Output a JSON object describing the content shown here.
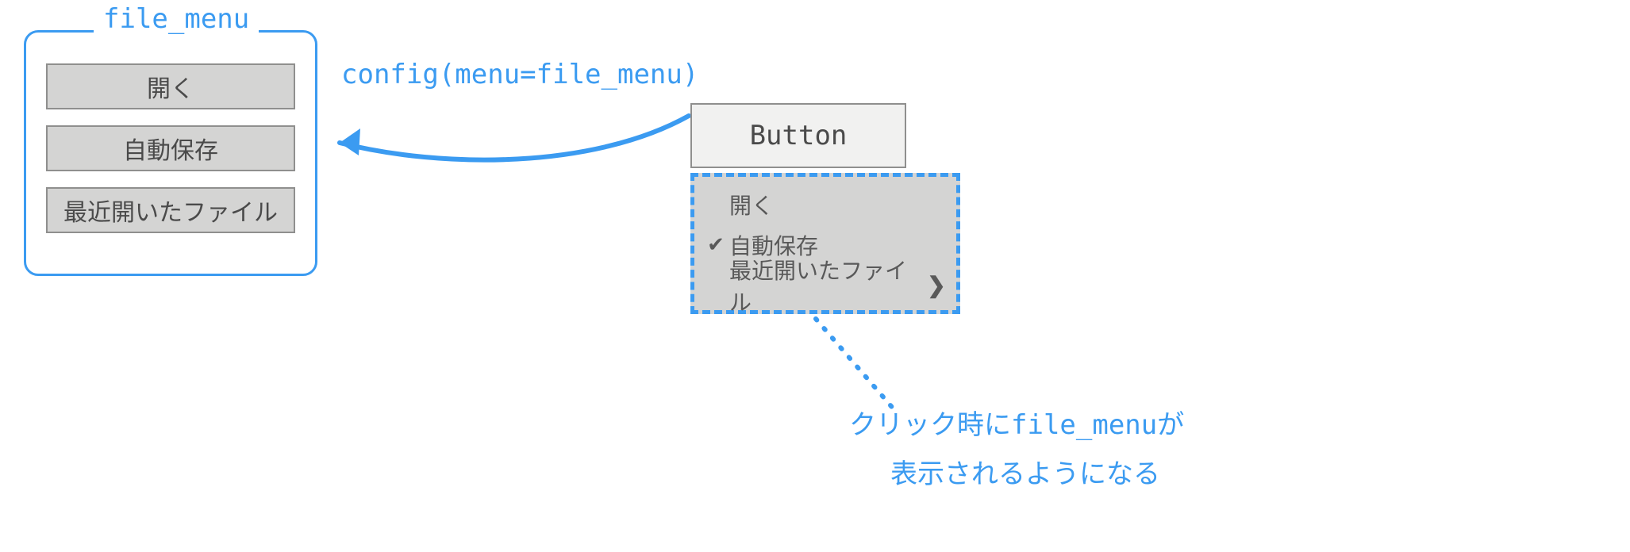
{
  "frame": {
    "legend": "file_menu",
    "items": [
      "開く",
      "自動保存",
      "最近開いたファイル"
    ]
  },
  "config_text": "config(menu=file_menu)",
  "button_label": "Button",
  "dropdown": {
    "items": [
      {
        "checked": false,
        "label": "開く",
        "submenu": false
      },
      {
        "checked": true,
        "label": "自動保存",
        "submenu": false
      },
      {
        "checked": false,
        "label": "最近開いたファイル",
        "submenu": true
      }
    ]
  },
  "note": {
    "line1_pre": "クリック時に",
    "line1_code": "file_menu",
    "line1_post": "が",
    "line2": "表示されるようになる"
  },
  "glyphs": {
    "check": "✔",
    "chevron": "❯"
  }
}
